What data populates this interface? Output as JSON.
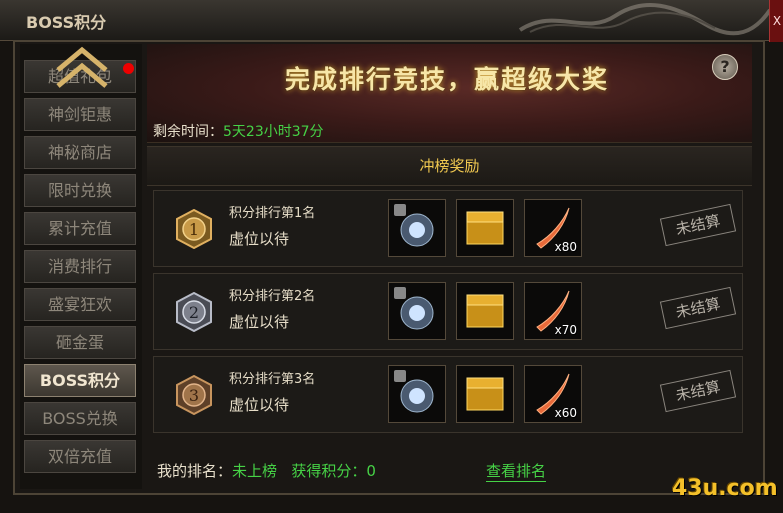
{
  "window": {
    "title": "BOSS积分",
    "close_label": "X"
  },
  "sidebar": {
    "items": [
      {
        "label": "超值礼包",
        "active": false,
        "has_dot": true
      },
      {
        "label": "神剑钜惠",
        "active": false
      },
      {
        "label": "神秘商店",
        "active": false
      },
      {
        "label": "限时兑换",
        "active": false
      },
      {
        "label": "累计充值",
        "active": false
      },
      {
        "label": "消费排行",
        "active": false
      },
      {
        "label": "盛宴狂欢",
        "active": false
      },
      {
        "label": "砸金蛋",
        "active": false
      },
      {
        "label": "BOSS积分",
        "active": true
      },
      {
        "label": "BOSS兑换",
        "active": false
      },
      {
        "label": "双倍充值",
        "active": false
      }
    ]
  },
  "banner": {
    "title": "完成排行竞技，赢超级大奖",
    "help_label": "?",
    "time_label": "剩余时间：",
    "time_value": "5天23小时37分"
  },
  "rewards": {
    "section_title": "冲榜奖励",
    "rows": [
      {
        "medal": "1",
        "rank_title": "积分排行第1名",
        "holder": "虚位以待",
        "status": "未结算",
        "items": [
          {
            "icon": "crystal-orb-icon",
            "locked": true,
            "count": ""
          },
          {
            "icon": "treasure-chest-icon",
            "locked": false,
            "count": ""
          },
          {
            "icon": "flame-blade-icon",
            "locked": false,
            "count": "x80"
          }
        ]
      },
      {
        "medal": "2",
        "rank_title": "积分排行第2名",
        "holder": "虚位以待",
        "status": "未结算",
        "items": [
          {
            "icon": "crystal-orb-icon",
            "locked": true,
            "count": ""
          },
          {
            "icon": "treasure-chest-icon",
            "locked": false,
            "count": ""
          },
          {
            "icon": "flame-blade-icon",
            "locked": false,
            "count": "x70"
          }
        ]
      },
      {
        "medal": "3",
        "rank_title": "积分排行第3名",
        "holder": "虚位以待",
        "status": "未结算",
        "items": [
          {
            "icon": "crystal-orb-icon",
            "locked": true,
            "count": ""
          },
          {
            "icon": "treasure-chest-icon",
            "locked": false,
            "count": ""
          },
          {
            "icon": "flame-blade-icon",
            "locked": false,
            "count": "x60"
          }
        ]
      }
    ]
  },
  "footer": {
    "my_rank_label": "我的排名：",
    "my_rank_value": "未上榜",
    "points_label": "获得积分：",
    "points_value": "0",
    "view_rank_link": "查看排名"
  },
  "watermark": "43u.com"
}
